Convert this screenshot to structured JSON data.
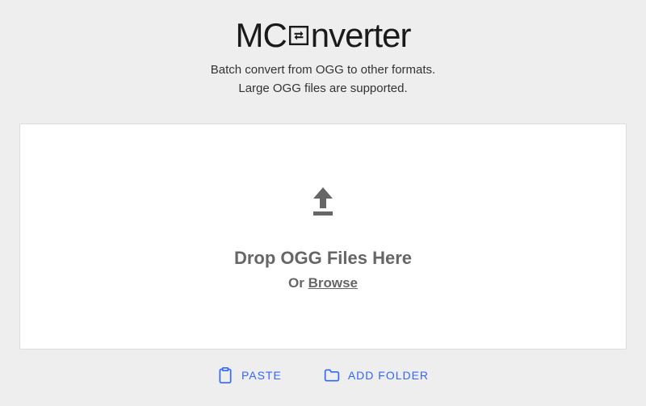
{
  "logo": {
    "part1": "MC",
    "part2": "nverter"
  },
  "subtitle": {
    "line1": "Batch convert from OGG to other formats.",
    "line2": "Large OGG files are supported."
  },
  "dropzone": {
    "title": "Drop OGG Files Here",
    "or": "Or ",
    "browse": "Browse"
  },
  "actions": {
    "paste": "PASTE",
    "addFolder": "ADD FOLDER"
  },
  "colors": {
    "accent": "#3366ff",
    "muted": "#666666"
  }
}
